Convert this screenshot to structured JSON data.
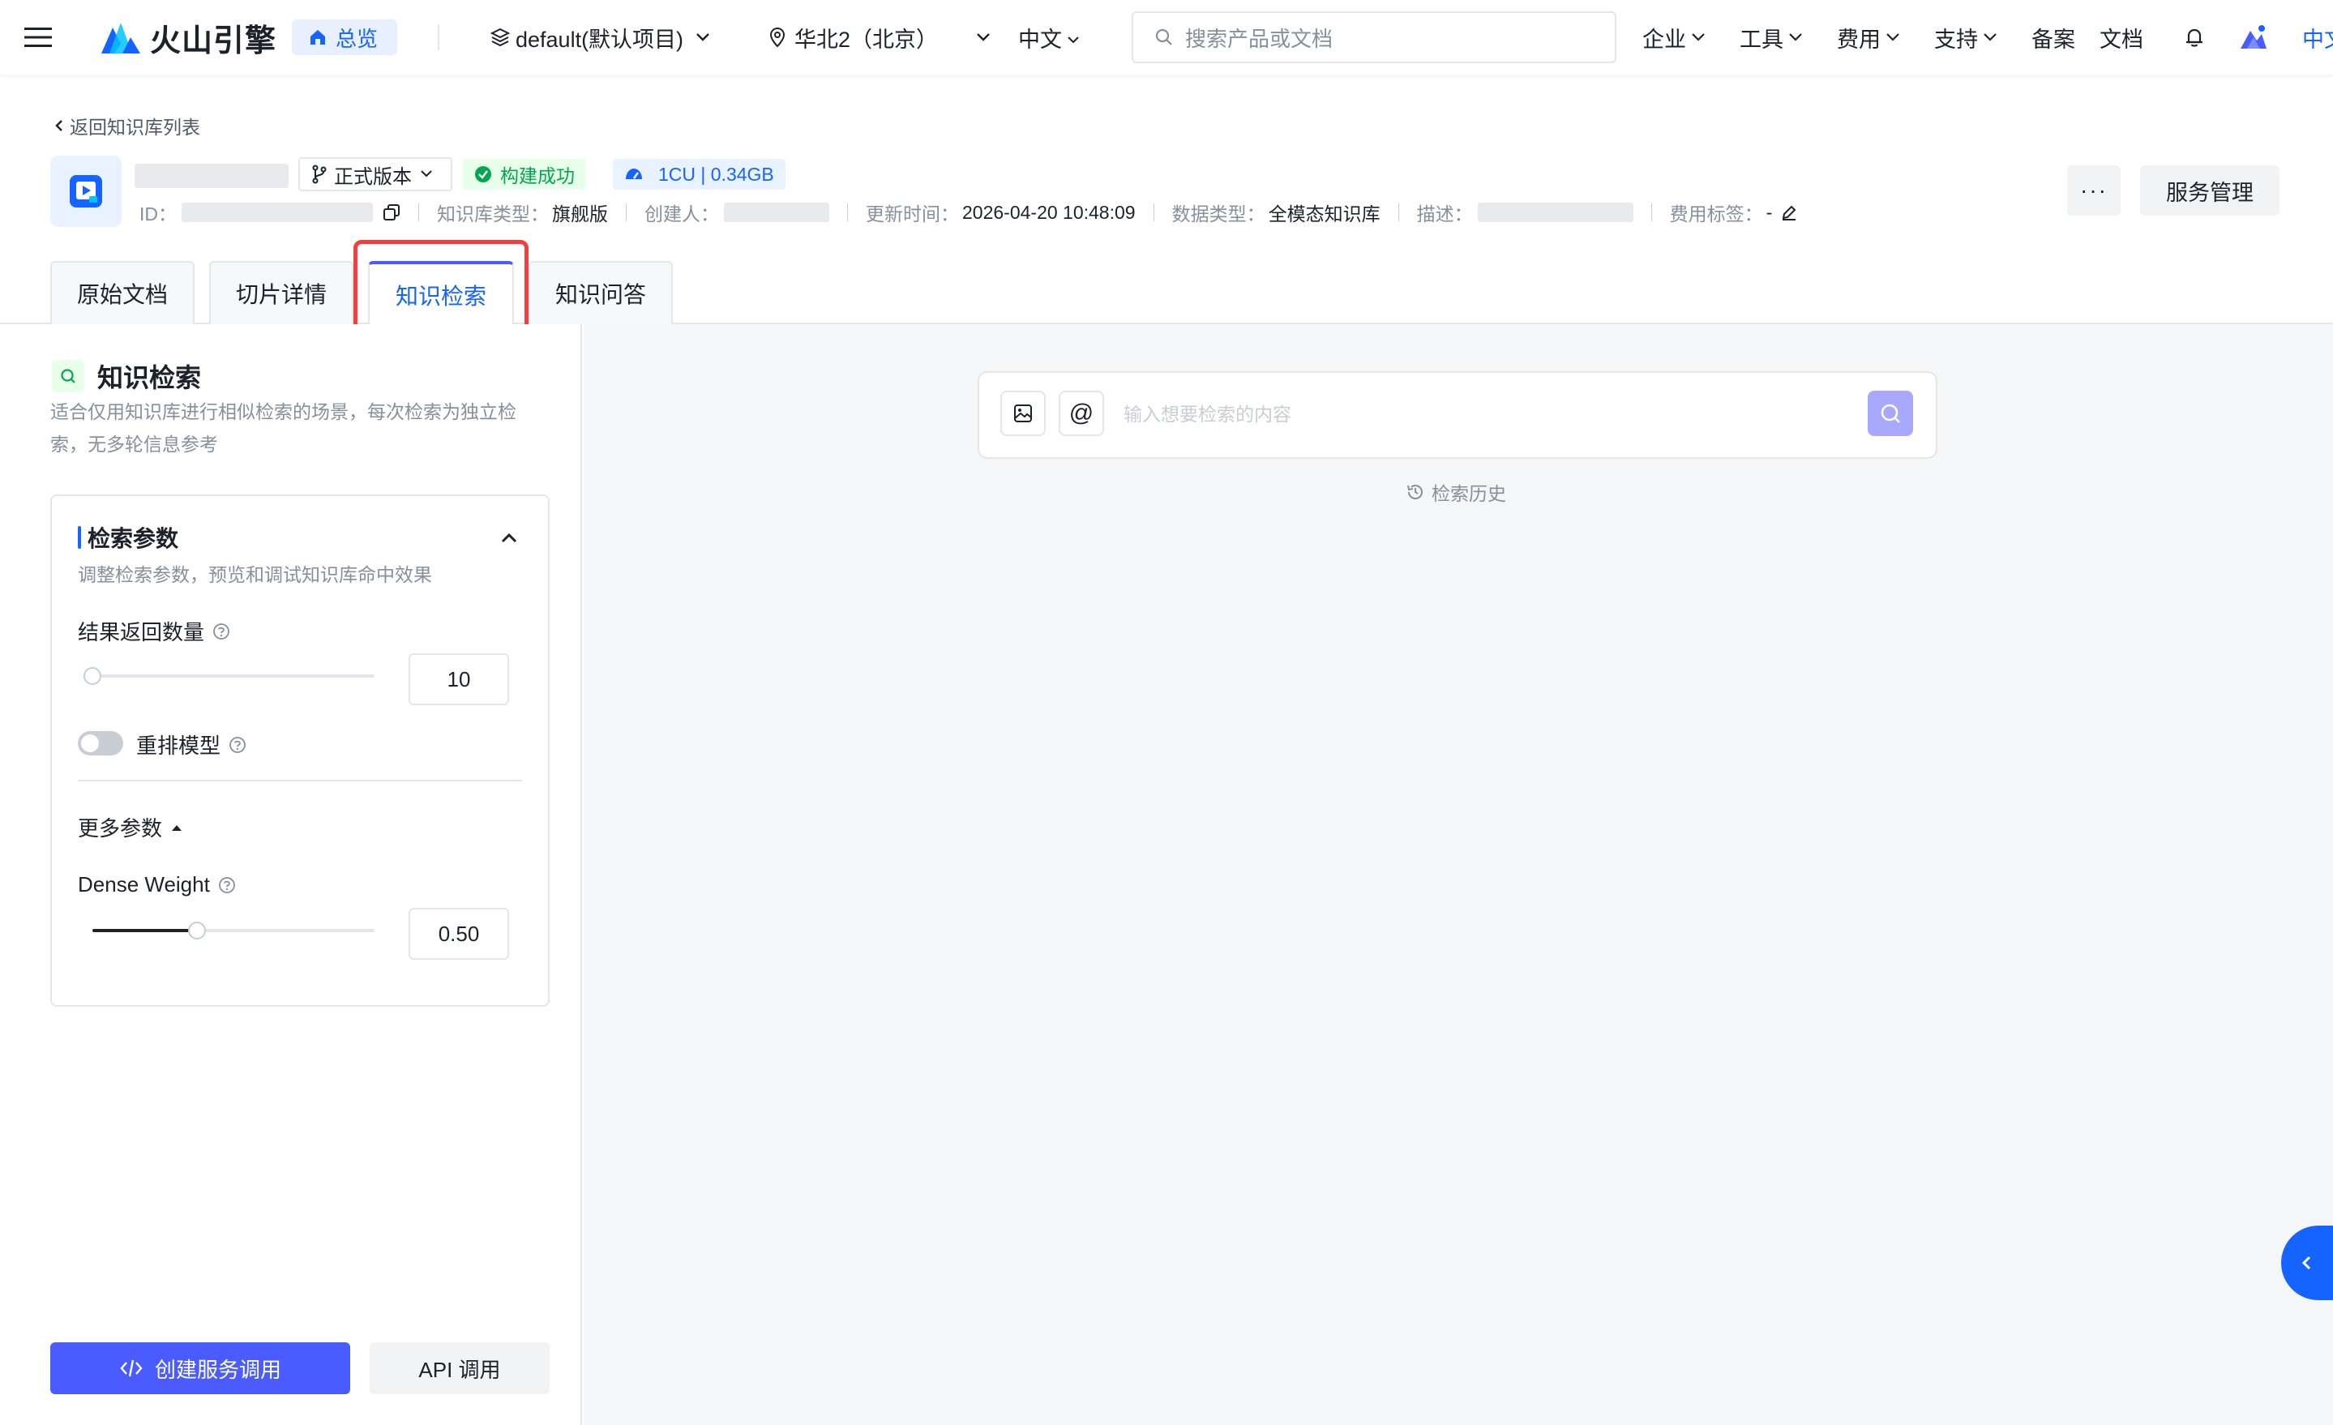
{
  "topbar": {
    "brand": "火山引擎",
    "overview": "总览",
    "project": "default(默认项目)",
    "region": "华北2（北京）",
    "language": "中文",
    "search_placeholder": "搜索产品或文档",
    "menu": [
      {
        "label": "企业",
        "dropdown": true
      },
      {
        "label": "工具",
        "dropdown": true
      },
      {
        "label": "费用",
        "dropdown": true
      },
      {
        "label": "支持",
        "dropdown": true
      },
      {
        "label": "备案",
        "dropdown": false
      },
      {
        "label": "文档",
        "dropdown": false
      }
    ],
    "language_short": "中文",
    "icons": [
      "menu-icon",
      "home-icon",
      "layers-icon",
      "location-icon",
      "search-icon",
      "bell-icon",
      "avatar"
    ]
  },
  "header": {
    "back_label": "返回知识库列表",
    "version": "正式版本",
    "status": "构建成功",
    "capacity": "1CU | 0.34GB",
    "meta": {
      "id_label": "ID：",
      "kb_type_label": "知识库类型：",
      "kb_type_value": "旗舰版",
      "creator_label": "创建人：",
      "updated_label": "更新时间：",
      "updated_value": "2026-04-20 10:48:09",
      "data_type_label": "数据类型：",
      "data_type_value": "全模态知识库",
      "desc_label": "描述：",
      "tags_label": "费用标签：",
      "tags_value": "-"
    },
    "more_label": "···",
    "service_label": "服务管理"
  },
  "tabs": [
    {
      "label": "原始文档",
      "active": false
    },
    {
      "label": "切片详情",
      "active": false
    },
    {
      "label": "知识检索",
      "active": true
    },
    {
      "label": "知识问答",
      "active": false
    }
  ],
  "panel": {
    "title": "知识检索",
    "description": "适合仅用知识库进行相似检索的场景，每次检索为独立检索，无多轮信息参考",
    "card": {
      "title": "检索参数",
      "description": "调整检索参数，预览和调试知识库命中效果",
      "result_count_label": "结果返回数量",
      "result_count_value": "10",
      "result_count_fraction": 0.0,
      "rerank_label": "重排模型",
      "rerank_enabled": false,
      "more_params_label": "更多参数",
      "dense_weight_label": "Dense Weight",
      "dense_weight_value": "0.50",
      "dense_weight_fraction": 0.37
    },
    "create_service_label": "创建服务调用",
    "api_label": "API 调用"
  },
  "retrieval": {
    "placeholder": "输入想要检索的内容",
    "at_symbol": "@",
    "history_label": "检索历史"
  },
  "colors": {
    "accent": "#1664ff",
    "primary_button": "#4a5cff",
    "success": "#00a650",
    "highlight_border": "#f04040",
    "submit_button": "#a8a8ff"
  }
}
